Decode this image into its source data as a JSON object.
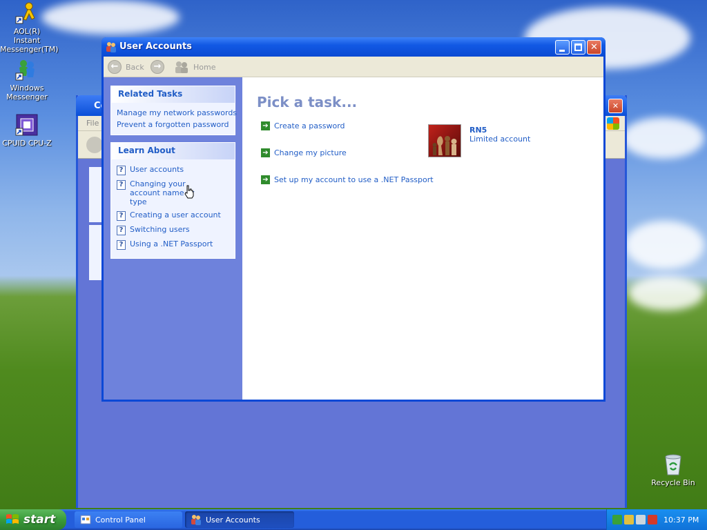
{
  "desktop": {
    "icons": [
      {
        "label": "AOL(R) Instant Messenger(TM)"
      },
      {
        "label": "Windows Messenger"
      },
      {
        "label": "CPUID CPU-Z"
      },
      {
        "label": "Recycle Bin"
      }
    ]
  },
  "bg_window": {
    "title_partial": "Co",
    "menu_partial": "File"
  },
  "window": {
    "title": "User Accounts",
    "nav": {
      "back": "Back",
      "home": "Home"
    }
  },
  "sidebar": {
    "related_tasks": {
      "heading": "Related Tasks",
      "items": [
        "Manage my network passwords",
        "Prevent a forgotten password"
      ]
    },
    "learn_about": {
      "heading": "Learn About",
      "items": [
        "User accounts",
        "Changing your account name or type",
        "Creating a user account",
        "Switching users",
        "Using a .NET Passport"
      ]
    }
  },
  "main": {
    "heading": "Pick a task...",
    "tasks": [
      "Create a password",
      "Change my picture",
      "Set up my account to use a .NET Passport"
    ],
    "account": {
      "name": "RN5",
      "type": "Limited account"
    }
  },
  "taskbar": {
    "start": "start",
    "buttons": [
      "Control Panel",
      "User Accounts"
    ],
    "clock": "10:37 PM"
  },
  "colors": {
    "link": "#215dc6",
    "title_bar": "#0a4ad3",
    "sidebar": "#6e82dc",
    "heading": "#7c8fc6",
    "task_arrow": "#2f8b2c"
  }
}
